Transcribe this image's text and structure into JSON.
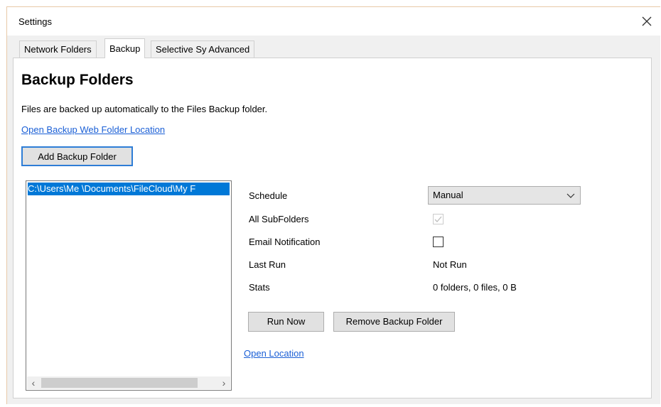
{
  "window": {
    "title": "Settings"
  },
  "tabs": [
    {
      "label": "Network Folders",
      "active": false
    },
    {
      "label": "Backup",
      "active": true
    },
    {
      "label": "Selective Sy Advanced",
      "active": false
    }
  ],
  "backup": {
    "heading": "Backup Folders",
    "description": "Files are backed up automatically to the Files Backup folder.",
    "open_web_link": "Open Backup Web Folder Location",
    "add_button": "Add Backup Folder",
    "folders": [
      "C:\\Users\\Me \\Documents\\FileCloud\\My F"
    ],
    "details": {
      "schedule_label": "Schedule",
      "schedule_value": "Manual",
      "subfolders_label": "All SubFolders",
      "subfolders_checked": true,
      "email_label": "Email Notification",
      "email_checked": false,
      "last_run_label": "Last Run",
      "last_run_value": "Not Run",
      "stats_label": "Stats",
      "stats_value": "0 folders, 0 files, 0 B"
    },
    "run_now_button": "Run Now",
    "remove_button": "Remove Backup Folder",
    "open_location_link": "Open Location"
  },
  "colors": {
    "selection": "#0078d7",
    "link": "#1a5fd6",
    "focus_border": "#2e7dd6"
  },
  "icons": {
    "close": "close-icon",
    "dropdown": "chevron-down-icon",
    "scroll_left": "scroll-left-icon",
    "scroll_right": "scroll-right-icon"
  }
}
